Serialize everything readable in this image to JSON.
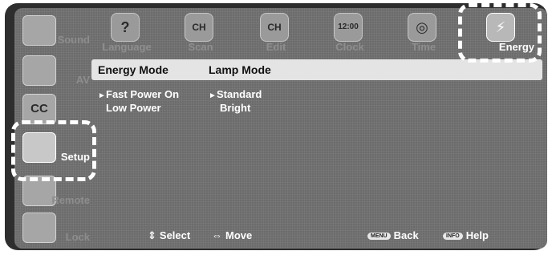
{
  "sidebar": {
    "items": [
      {
        "label": "Sound",
        "icon": "speaker-icon"
      },
      {
        "label": "AV",
        "icon": "av-connector-icon"
      },
      {
        "label": "",
        "icon": "cc-icon"
      },
      {
        "label": "Setup",
        "icon": "setup-tv-icon",
        "active": true
      },
      {
        "label": "Remote",
        "icon": "remote-icon"
      },
      {
        "label": "Lock",
        "icon": "lock-icon"
      }
    ]
  },
  "tabs": [
    {
      "label": "Language",
      "icon": "question-icon",
      "glyph": "?"
    },
    {
      "label": "Scan",
      "icon": "antenna-ch-icon",
      "glyph": "CH"
    },
    {
      "label": "Edit",
      "icon": "ch-edit-icon",
      "glyph": "CH"
    },
    {
      "label": "Clock",
      "icon": "clock-icon",
      "glyph": "12:00"
    },
    {
      "label": "Time",
      "icon": "globe-icon",
      "glyph": "◎"
    },
    {
      "label": "Energy",
      "icon": "lightning-icon",
      "glyph": "⚡",
      "active": true
    }
  ],
  "header": {
    "col1": "Energy Mode",
    "col2": "Lamp Mode"
  },
  "energy_mode": {
    "selected": "Fast Power On",
    "other": "Low Power",
    "marker": "►"
  },
  "lamp_mode": {
    "selected": "Standard",
    "other": "Bright",
    "marker": "►"
  },
  "footer": {
    "select": {
      "glyph": "⇕",
      "label": "Select"
    },
    "move": {
      "glyph": "⇔",
      "label": "Move"
    },
    "back": {
      "key": "MENU",
      "label": "Back"
    },
    "help": {
      "key": "INFO",
      "label": "Help"
    }
  },
  "colors": {
    "screen": "#6c6c6c",
    "header_bar": "#e4e4e4",
    "highlight": "#ffffff"
  }
}
